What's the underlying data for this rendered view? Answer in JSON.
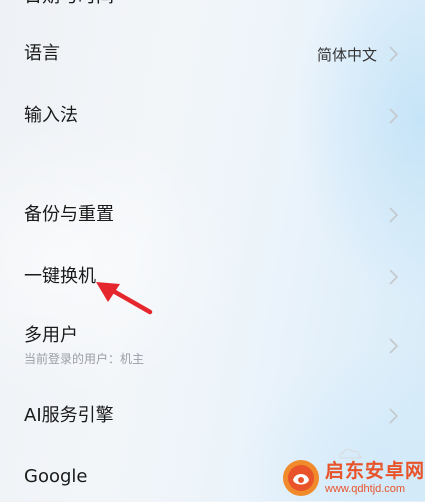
{
  "settings": {
    "top_partial": "日期与时间",
    "language": {
      "label": "语言",
      "value": "简体中文"
    },
    "input_method": {
      "label": "输入法"
    },
    "backup_reset": {
      "label": "备份与重置"
    },
    "phone_clone": {
      "label": "一键换机"
    },
    "multi_user": {
      "label": "多用户",
      "sub": "当前登录的用户：机主"
    },
    "ai_engine": {
      "label": "AI服务引擎"
    },
    "google": {
      "label": "Google"
    }
  },
  "annotation": {
    "arrow_color": "#e5262d"
  },
  "watermark": {
    "title": "启东安卓网",
    "url": "www.qdhtjd.com",
    "color": "#e8532a"
  },
  "colors": {
    "text": "#1a1a1a",
    "secondary": "#9a9ea4",
    "chevron": "#c4c8cd"
  }
}
